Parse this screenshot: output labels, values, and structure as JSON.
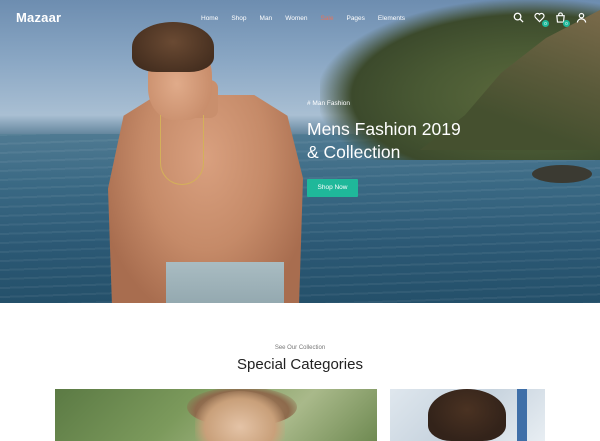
{
  "brand": {
    "logo": "Mazaar"
  },
  "nav": {
    "items": [
      {
        "label": "Home"
      },
      {
        "label": "Shop"
      },
      {
        "label": "Man"
      },
      {
        "label": "Women"
      },
      {
        "label": "Sale"
      },
      {
        "label": "Pages"
      },
      {
        "label": "Elements"
      }
    ],
    "active_item": "Sale",
    "icons": [
      "search-icon",
      "heart-icon",
      "cart-icon",
      "user-icon"
    ],
    "wishlist_count": "0",
    "cart_count": "0"
  },
  "hero": {
    "tag": "# Man Fashion",
    "title_line1": "Mens Fashion 2019",
    "title_line2": "& Collection",
    "button_label": "Shop Now"
  },
  "section": {
    "kicker": "See Our Collection",
    "title": "Special Categories"
  },
  "colors": {
    "accent": "#1fb89a",
    "active_nav": "#e8725a",
    "title_text": "#222222"
  }
}
